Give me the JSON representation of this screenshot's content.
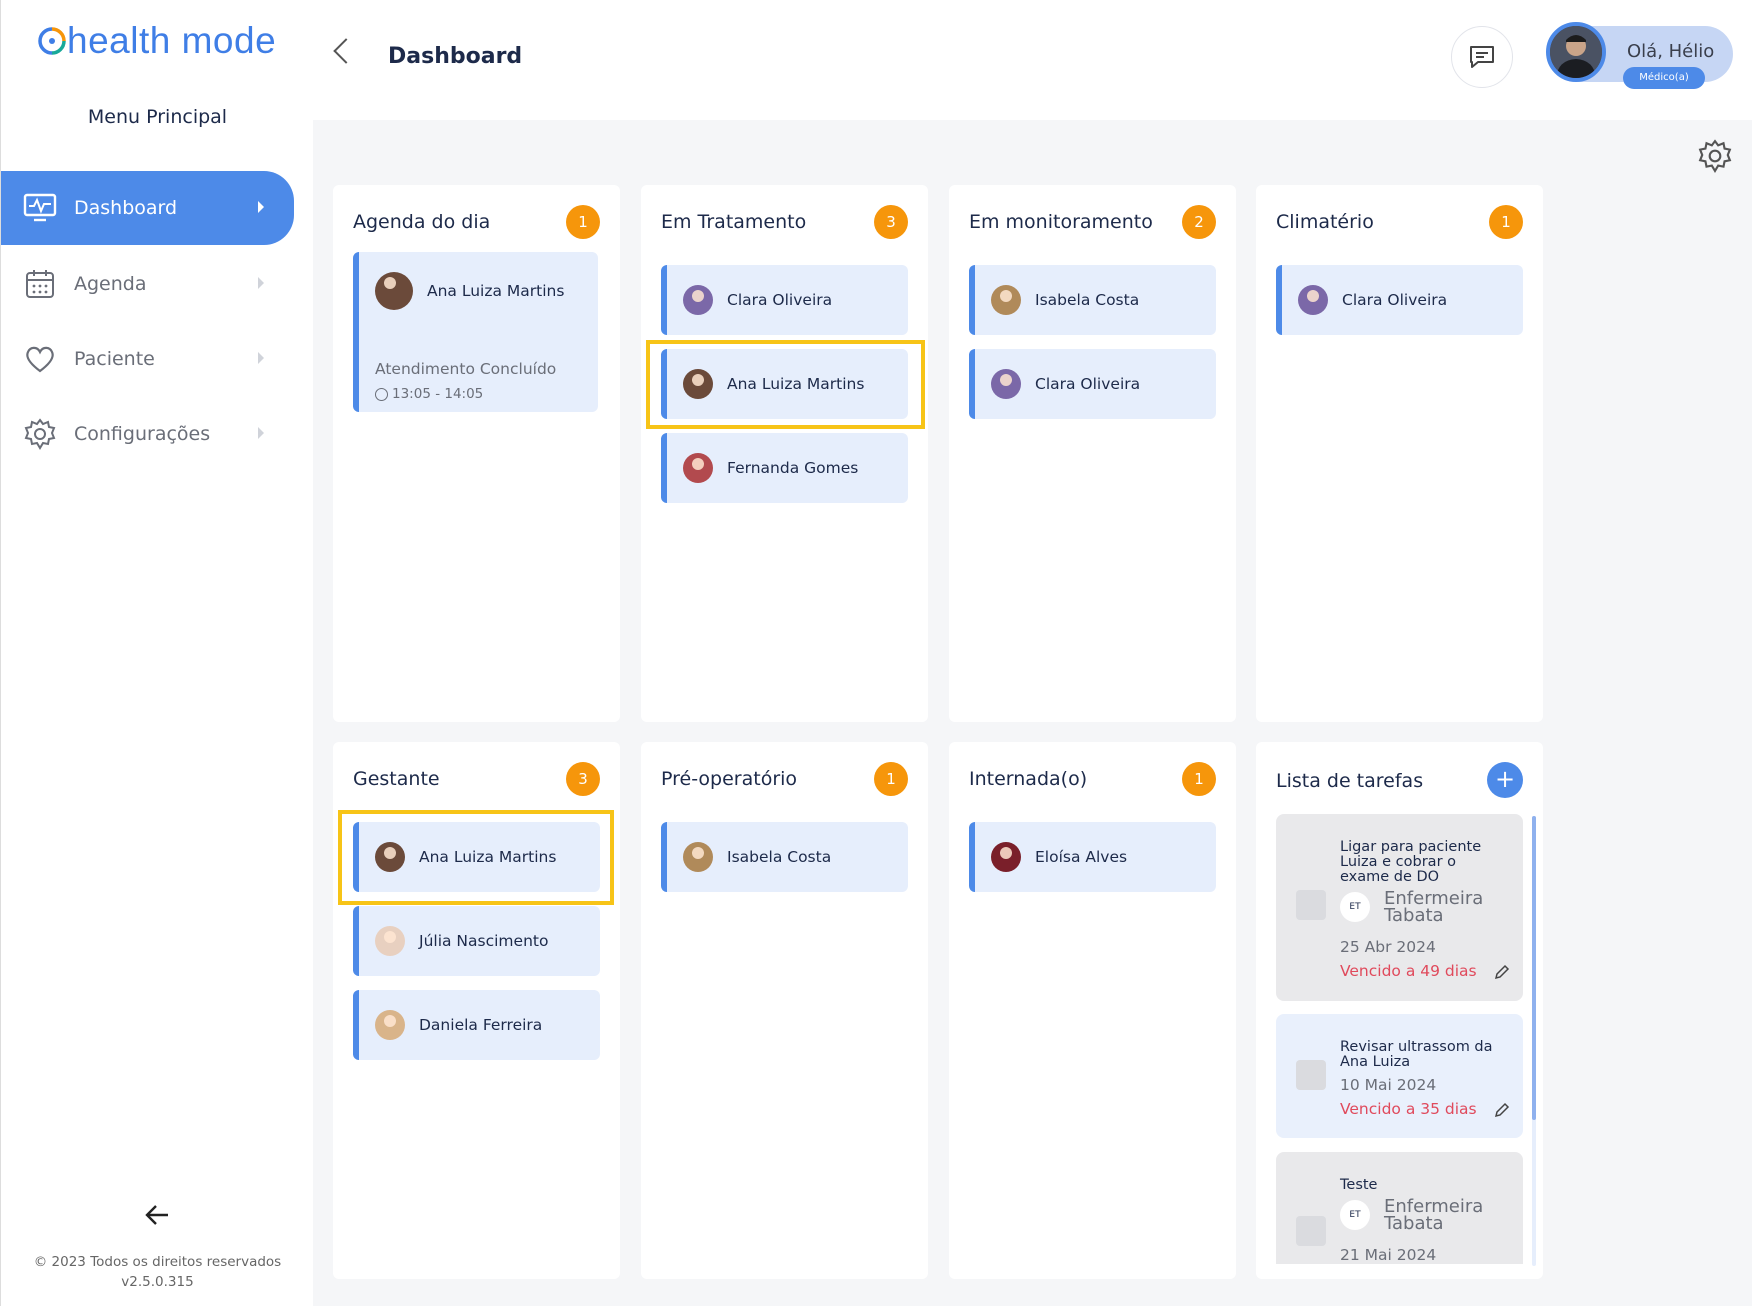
{
  "app": {
    "logo_text": "health mode",
    "menu_title": "Menu Principal",
    "copyright": "© 2023 Todos os direitos reservados",
    "version": "v2.5.0.315"
  },
  "sidebar": {
    "items": [
      {
        "label": "Dashboard",
        "icon": "monitor-icon",
        "active": true
      },
      {
        "label": "Agenda",
        "icon": "calendar-icon",
        "active": false
      },
      {
        "label": "Paciente",
        "icon": "heart-icon",
        "active": false
      },
      {
        "label": "Configurações",
        "icon": "gear-icon",
        "active": false
      }
    ]
  },
  "header": {
    "title": "Dashboard",
    "greeting": "Olá, Hélio",
    "role": "Médico(a)"
  },
  "colors": {
    "accent": "#4d8ae8",
    "badge": "#f6960b",
    "highlight": "#f7c417",
    "overdue": "#e04a5c"
  },
  "boards": [
    {
      "title": "Agenda do dia",
      "count": "1",
      "appointment": {
        "name": "Ana Luiza Martins",
        "status": "Atendimento Concluído",
        "time": "13:05 - 14:05"
      }
    },
    {
      "title": "Em Tratamento",
      "count": "3",
      "patients": [
        "Clara Oliveira",
        "Ana Luiza Martins",
        "Fernanda Gomes"
      ]
    },
    {
      "title": "Em monitoramento",
      "count": "2",
      "patients": [
        "Isabela  Costa",
        "Clara Oliveira"
      ]
    },
    {
      "title": "Climatério",
      "count": "1",
      "patients": [
        "Clara Oliveira"
      ]
    },
    {
      "title": "Gestante",
      "count": "3",
      "patients": [
        "Ana Luiza Martins",
        "Júlia Nascimento",
        "Daniela Ferreira"
      ]
    },
    {
      "title": "Pré-operatório",
      "count": "1",
      "patients": [
        "Isabela  Costa"
      ]
    },
    {
      "title": "Internada(o)",
      "count": "1",
      "patients": [
        "Eloísa Alves"
      ]
    }
  ],
  "tasks": {
    "title": "Lista de tarefas",
    "add_label": "+",
    "items": [
      {
        "title": "Ligar para paciente Luiza e cobrar o exame de DO",
        "assignee_initials": "ET",
        "assignee": "Enfermeira Tabata",
        "date": "25 Abr 2024",
        "overdue": "Vencido a 49 dias"
      },
      {
        "title": "Revisar ultrassom da Ana Luiza",
        "date": "10 Mai 2024",
        "overdue": "Vencido a 35 dias"
      },
      {
        "title": "Teste",
        "assignee_initials": "ET",
        "assignee": "Enfermeira Tabata",
        "date": "21 Mai 2024"
      }
    ]
  }
}
